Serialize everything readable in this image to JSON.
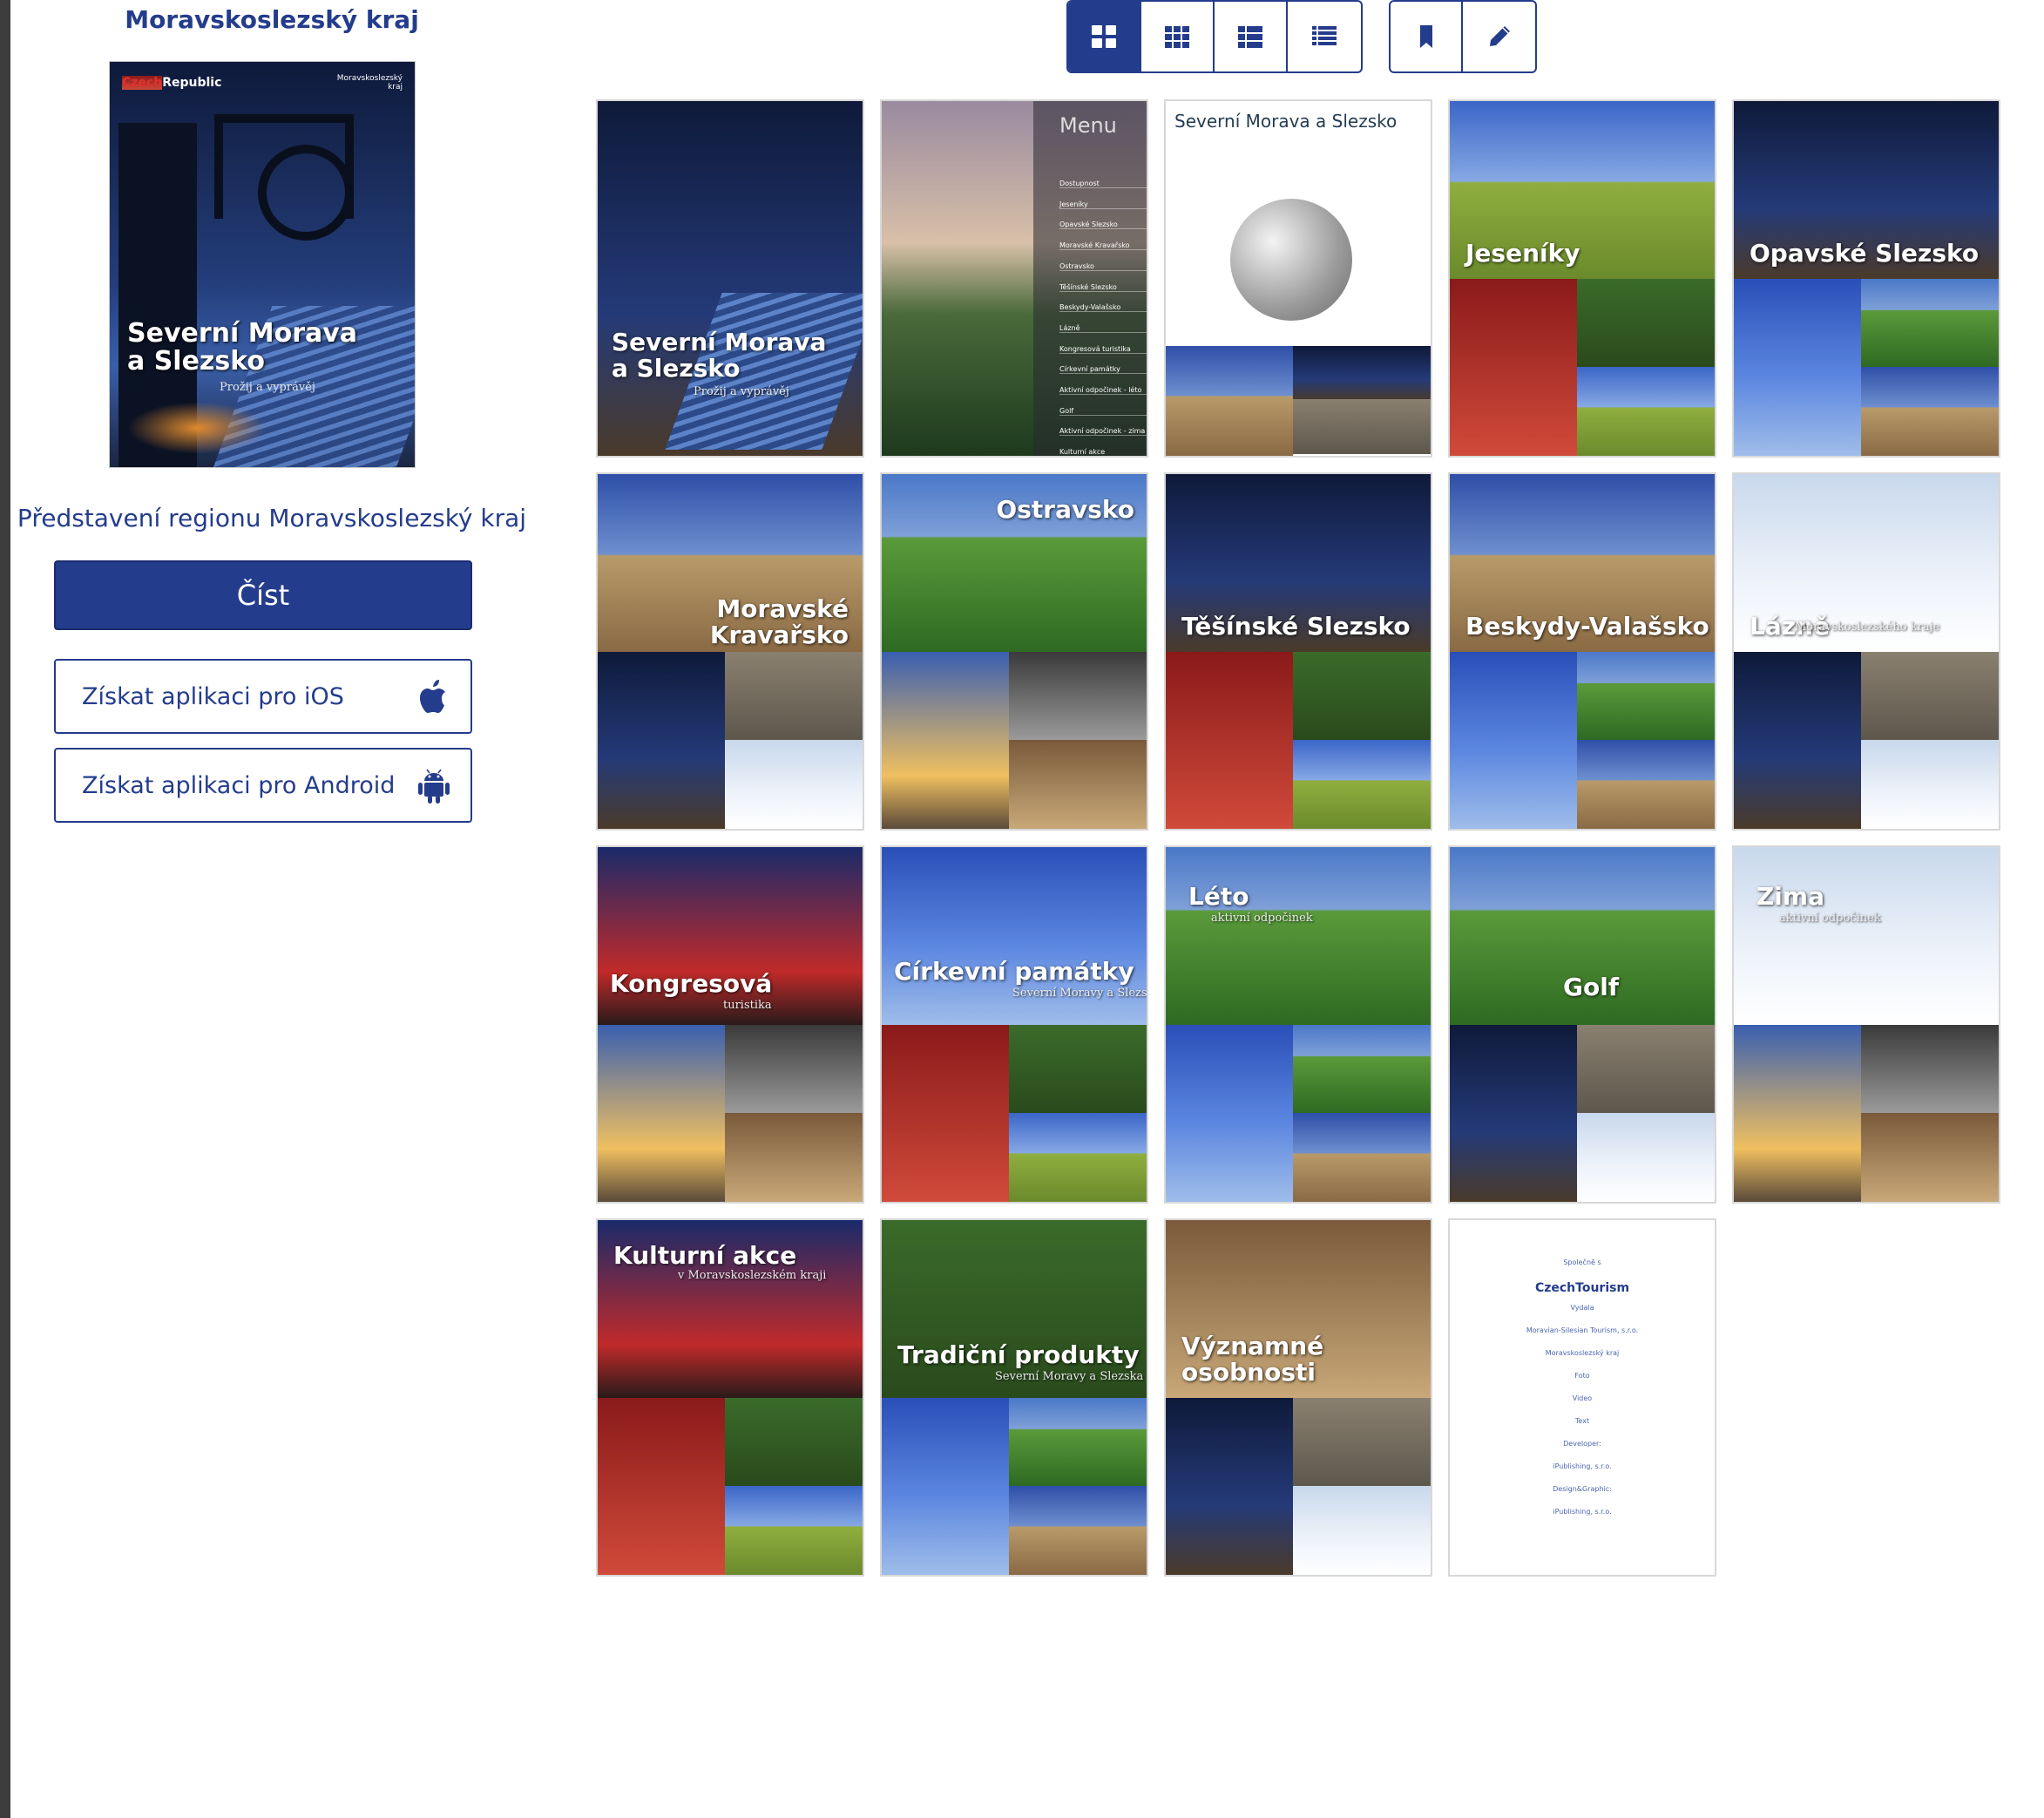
{
  "sidebar": {
    "title": "Moravskoslezský kraj",
    "cover": {
      "brand_red": "Czech",
      "brand_white": "Republic",
      "logo_text": "Moravskoslezský kraj",
      "title_line1": "Severní Morava",
      "title_line2": "a Slezsko",
      "subtitle": "Prožij a vyprávěj"
    },
    "intro": "Představení regionu Moravskoslezský kraj",
    "read_button": "Číst",
    "ios_button": "Získat aplikaci pro iOS",
    "android_button": "Získat aplikaci pro Android"
  },
  "toolbar": {
    "view_buttons": [
      "large-grid-icon",
      "small-grid-icon",
      "list-icon",
      "compact-list-icon"
    ],
    "active_view": 0,
    "tool_buttons": [
      "bookmark-icon",
      "pencil-icon"
    ]
  },
  "pages": [
    {
      "title": "Severní Morava\na Slezsko",
      "subtitle": "Prožij a vyprávěj",
      "style": "night"
    },
    {
      "title": "Menu",
      "subtitle": "",
      "style": "dusk",
      "menu_items": [
        "Dostupnost",
        "Jeseníky",
        "Opavské Slezsko",
        "Moravské Kravařsko",
        "Ostravsko",
        "Těšínské Slezsko",
        "Beskydy-Valašsko",
        "Lázně",
        "Kongresová turistika",
        "Církevní památky",
        "Aktivní odpočinek - léto",
        "Golf",
        "Aktivní odpočinek - zima",
        "Kulturní akce"
      ]
    },
    {
      "title": "Severní Morava a Slezsko",
      "subtitle": "",
      "style": "white"
    },
    {
      "title": "Jeseníky",
      "subtitle": "",
      "style": "meadow"
    },
    {
      "title": "Opavské Slezsko",
      "subtitle": "",
      "style": "night"
    },
    {
      "title": "Moravské\nKravařsko",
      "subtitle": "",
      "style": "town"
    },
    {
      "title": "Ostravsko",
      "subtitle": "",
      "style": "green"
    },
    {
      "title": "Těšínské Slezsko",
      "subtitle": "",
      "style": "night"
    },
    {
      "title": "Beskydy-Valašsko",
      "subtitle": "",
      "style": "town"
    },
    {
      "title": "Lázně",
      "subtitle": "Moravskoslezského kraje",
      "style": "snow"
    },
    {
      "title": "Kongresová",
      "subtitle": "turistika",
      "style": "concert"
    },
    {
      "title": "Církevní památky",
      "subtitle": "Severní Moravy a Slezska",
      "style": "sky"
    },
    {
      "title": "Léto",
      "subtitle": "aktivní odpočinek",
      "style": "green"
    },
    {
      "title": "Golf",
      "subtitle": "",
      "style": "green"
    },
    {
      "title": "Zima",
      "subtitle": "aktivní odpočinek",
      "style": "snow"
    },
    {
      "title": "Kulturní akce",
      "subtitle": "v Moravskoslezském kraji",
      "style": "concert"
    },
    {
      "title": "Tradiční produkty",
      "subtitle": "Severní Moravy a Slezska",
      "style": "forest"
    },
    {
      "title": "Významné\nosobnosti",
      "subtitle": "",
      "style": "interior"
    },
    {
      "title": "",
      "subtitle": "",
      "style": "white",
      "credits": [
        "Společně s",
        "CzechTourism",
        "Vydala",
        "Moravian-Silesian Tourism, s.r.o.",
        "Moravskoslezský kraj",
        "Foto",
        "Video",
        "Text",
        "Developer:",
        "iPublishing, s.r.o.",
        "Design&Graphic:",
        "iPublishing, s.r.o."
      ]
    }
  ]
}
